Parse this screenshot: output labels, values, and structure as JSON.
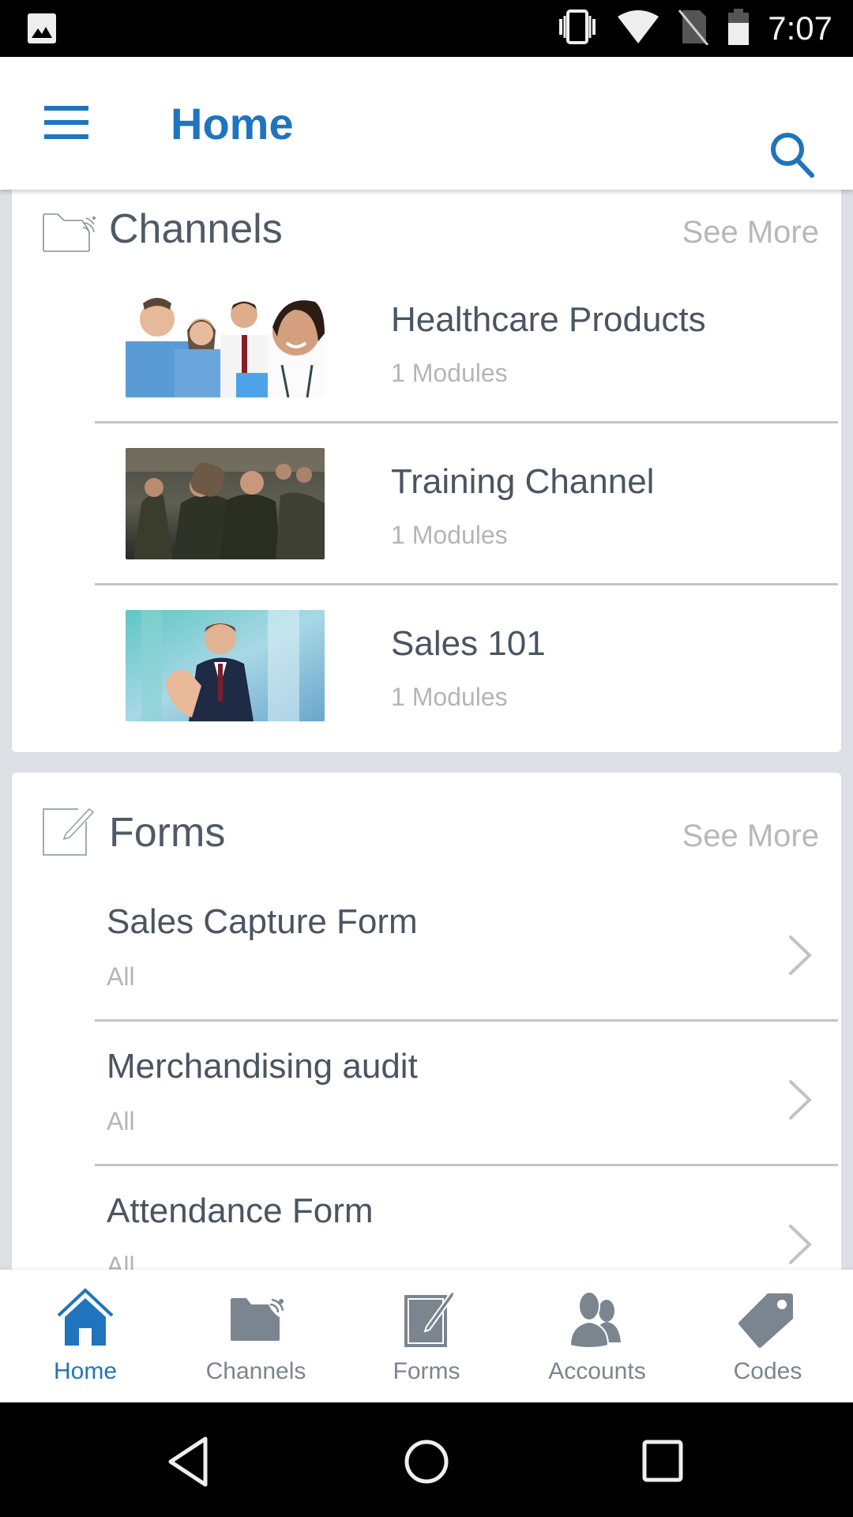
{
  "status_bar": {
    "time": "7:07",
    "icons": [
      "image-notification-icon",
      "vibrate-icon",
      "wifi-icon",
      "no-sim-icon",
      "battery-icon"
    ]
  },
  "app_bar": {
    "title": "Home",
    "menu_icon": "hamburger-menu-icon",
    "search_icon": "search-icon"
  },
  "channels_section": {
    "title": "Channels",
    "icon": "channel-folder-icon",
    "see_more": "See More",
    "items": [
      {
        "title": "Healthcare Products",
        "subtitle": "1 Modules",
        "thumbnail": "medical-team-photo"
      },
      {
        "title": "Training Channel",
        "subtitle": "1 Modules",
        "thumbnail": "soldiers-training-photo"
      },
      {
        "title": "Sales 101",
        "subtitle": "1 Modules",
        "thumbnail": "businessman-handshake-photo"
      }
    ]
  },
  "forms_section": {
    "title": "Forms",
    "icon": "form-edit-icon",
    "see_more": "See More",
    "items": [
      {
        "title": "Sales Capture Form",
        "subtitle": "All"
      },
      {
        "title": "Merchandising audit",
        "subtitle": "All"
      },
      {
        "title": "Attendance Form",
        "subtitle": "All"
      }
    ]
  },
  "bottom_nav": {
    "active": "Home",
    "items": [
      {
        "label": "Home",
        "icon": "home-icon"
      },
      {
        "label": "Channels",
        "icon": "channels-icon"
      },
      {
        "label": "Forms",
        "icon": "forms-icon"
      },
      {
        "label": "Accounts",
        "icon": "accounts-icon"
      },
      {
        "label": "Codes",
        "icon": "codes-tag-icon"
      }
    ]
  },
  "colors": {
    "accent": "#1f74bd",
    "inactive_icon": "#7a8590",
    "title_text": "#4a5462",
    "secondary_text": "#b5b5b5",
    "background": "#dcdfe3"
  }
}
